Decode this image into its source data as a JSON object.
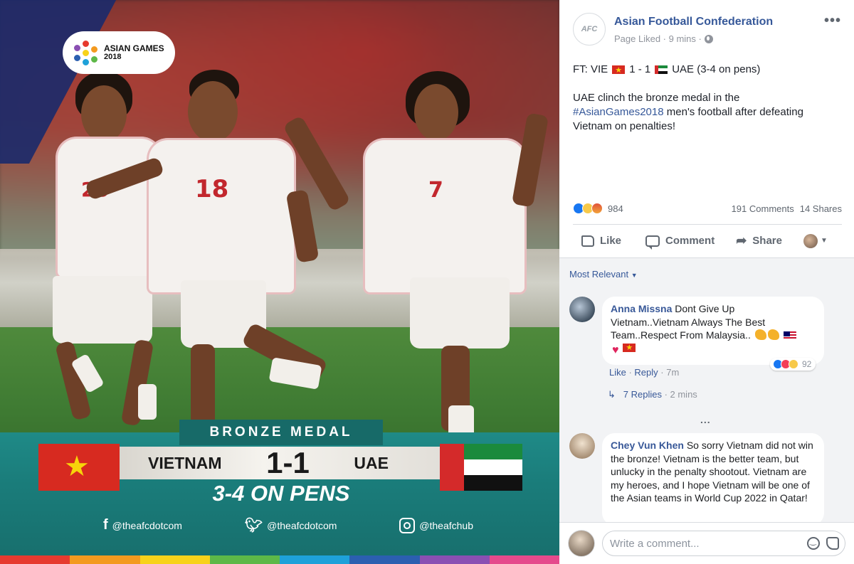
{
  "photo": {
    "logo_line1": "ASIAN GAMES",
    "logo_line2": "2018",
    "jersey_numbers": [
      "26",
      "18",
      "7"
    ],
    "bronze_label": "BRONZE MEDAL",
    "team_left": "VIETNAM",
    "score": "1-1",
    "team_right": "UAE",
    "pens_text": "3-4 ON PENS",
    "socials": [
      {
        "icon": "facebook-icon",
        "handle": "@theafcdotcom"
      },
      {
        "icon": "twitter-icon",
        "handle": "@theafcdotcom"
      },
      {
        "icon": "instagram-icon",
        "handle": "@theafchub"
      }
    ],
    "strip_colors": [
      "#e63a2f",
      "#f39a1f",
      "#f7d21a",
      "#5db848",
      "#1ea1d9",
      "#2b5fb0",
      "#8a4fb3",
      "#e54a8c"
    ]
  },
  "post": {
    "page_name": "Asian Football Confederation",
    "avatar_text": "AFC",
    "meta": "Page Liked · 9 mins ·",
    "score_line": {
      "prefix": "FT: VIE",
      "score": "1 - 1",
      "suffix": "UAE (3-4 on pens)"
    },
    "body_before": "UAE clinch the bronze medal in the",
    "hashtag": "#AsianGames2018",
    "body_after": "men's football after defeating Vietnam on penalties!",
    "reactions_count": "984",
    "comments_count": "191 Comments",
    "shares_count": "14 Shares",
    "actions": {
      "like": "Like",
      "comment": "Comment",
      "share": "Share"
    }
  },
  "comments": {
    "sort_label": "Most Relevant",
    "items": [
      {
        "author": "Anna Missna",
        "text": "Dont Give Up Vietnam..Vietnam Always The Best Team..Respect From Malaysia..",
        "like": "Like",
        "reply": "Reply",
        "time": "7m",
        "reactions": "92",
        "replies_link": "7 Replies",
        "replies_time": "2 mins"
      },
      {
        "author": "Chey Vun Khen",
        "text": "So sorry Vietnam did not win the bronze! Vietnam is the better team, but unlucky in the penalty shootout. Vietnam are my heroes, and I hope Vietnam will be one of the Asian teams in World Cup 2022 in Qatar!"
      }
    ],
    "more_label": "...",
    "input_placeholder": "Write a comment..."
  },
  "colors": {
    "fb_blue": "#365899",
    "vn_red": "#d72a20",
    "banner_teal": "#1a7c7a"
  }
}
